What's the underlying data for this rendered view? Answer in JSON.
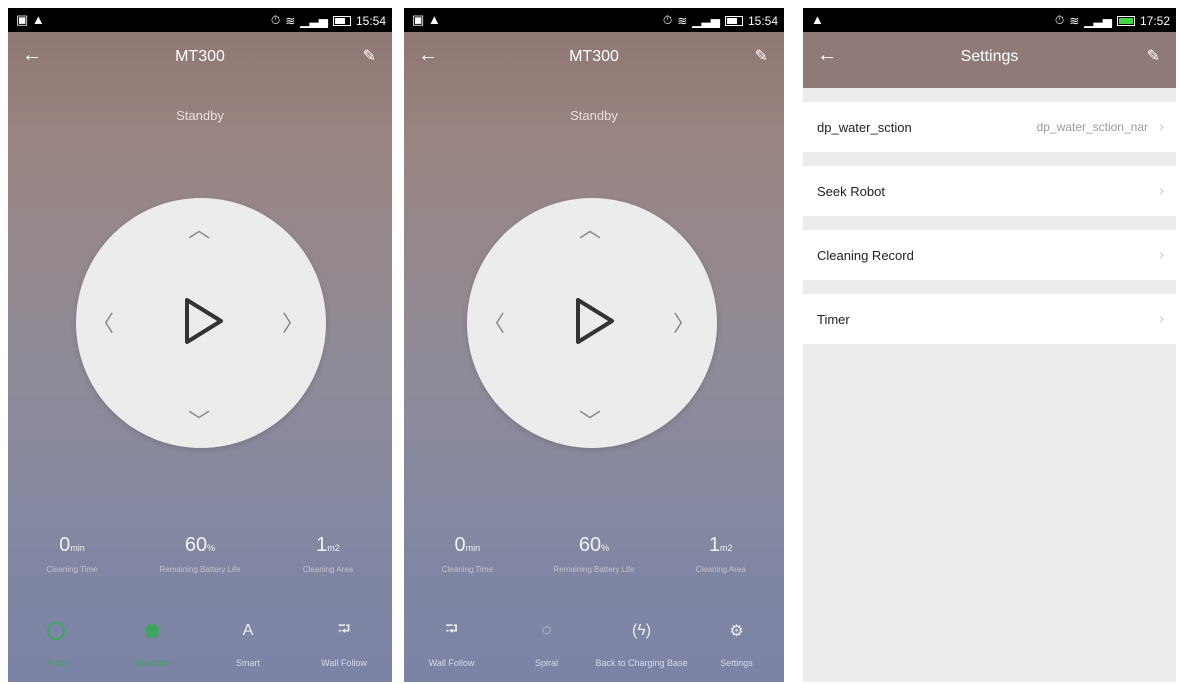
{
  "screen1": {
    "statusbar": {
      "time": "15:54"
    },
    "title": "MT300",
    "status": "Standby",
    "stats": [
      {
        "value": "0",
        "unit": "min",
        "label": "Cleaning Time"
      },
      {
        "value": "60",
        "unit": "%",
        "label": "Remaining Battery Life"
      },
      {
        "value": "1",
        "unit": "m2",
        "label": "Cleaning Area"
      }
    ],
    "modes": [
      {
        "label": "Auto",
        "icon": "ring-icon"
      },
      {
        "label": "Random",
        "icon": "dot-icon"
      },
      {
        "label": "Smart",
        "icon": "letter-a-icon"
      },
      {
        "label": "Wall Follow",
        "icon": "wall-follow-icon"
      }
    ]
  },
  "screen2": {
    "statusbar": {
      "time": "15:54"
    },
    "title": "MT300",
    "status": "Standby",
    "stats": [
      {
        "value": "0",
        "unit": "min",
        "label": "Cleaning Time"
      },
      {
        "value": "60",
        "unit": "%",
        "label": "Remaining Battery Life"
      },
      {
        "value": "1",
        "unit": "m2",
        "label": "Cleaning Area"
      }
    ],
    "modes": [
      {
        "label": "Wall Follow",
        "icon": "wall-follow-icon"
      },
      {
        "label": "Spiral",
        "icon": "spiral-icon"
      },
      {
        "label": "Back to Charging Base",
        "icon": "charging-icon"
      },
      {
        "label": "Settings",
        "icon": "gear-icon"
      }
    ]
  },
  "screen3": {
    "statusbar": {
      "time": "17:52"
    },
    "title": "Settings",
    "rows": [
      {
        "label": "dp_water_sction",
        "value": "dp_water_sction_nar"
      },
      {
        "label": "Seek Robot",
        "value": ""
      },
      {
        "label": "Cleaning Record",
        "value": ""
      },
      {
        "label": "Timer",
        "value": ""
      }
    ]
  },
  "colors": {
    "accent": "#3ea561"
  }
}
